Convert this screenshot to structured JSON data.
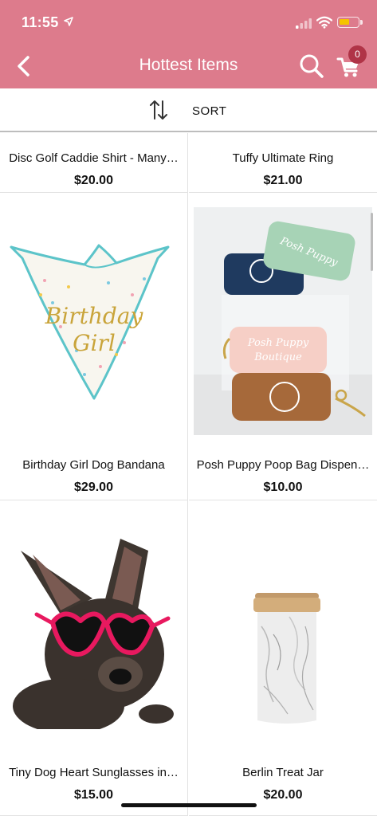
{
  "status_bar": {
    "time": "11:55"
  },
  "nav": {
    "title": "Hottest Items",
    "cart_count": "0"
  },
  "sort": {
    "label": "SORT"
  },
  "products": [
    {
      "name": "Disc Golf Caddie Shirt - Many…",
      "price": "$20.00"
    },
    {
      "name": "Tuffy Ultimate Ring",
      "price": "$21.00"
    },
    {
      "name": "Birthday Girl Dog Bandana",
      "price": "$29.00",
      "image_text": "Birthday Girl"
    },
    {
      "name": "Posh Puppy Poop Bag Dispen…",
      "price": "$10.00",
      "image_text": "Posh Puppy Boutique"
    },
    {
      "name": "Tiny Dog Heart Sunglasses in…",
      "price": "$15.00"
    },
    {
      "name": "Berlin Treat Jar",
      "price": "$20.00"
    }
  ],
  "colors": {
    "header": "#dd7b8c",
    "badge": "#b03447"
  }
}
